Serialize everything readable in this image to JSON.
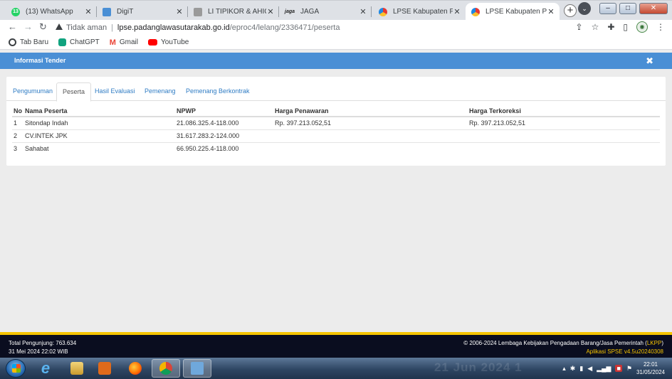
{
  "browser": {
    "tabs": [
      {
        "label": "(13) WhatsApp",
        "icon": "whatsapp-icon",
        "color": "#25d366",
        "badge": "13"
      },
      {
        "label": "DigiT",
        "icon": "document-icon",
        "color": "#4a8fd5",
        "badge": ""
      },
      {
        "label": "LI TIPIKOR & AHICW",
        "icon": "emblem-icon",
        "color": "#9a9a9a",
        "badge": ""
      },
      {
        "label": "JAGA",
        "icon": "jaga-icon",
        "color": "#222222",
        "badge": "jaga"
      },
      {
        "label": "LPSE Kabupaten Padan",
        "icon": "lpse-icon",
        "color": "#e53935",
        "badge": ""
      },
      {
        "label": "LPSE Kabupaten Padan",
        "icon": "lpse-icon",
        "color": "#e53935",
        "badge": ""
      }
    ],
    "active_tab_index": 5,
    "address": {
      "security_label": "Tidak aman",
      "host": "lpse.padanglawasutarakab.go.id",
      "path": "/eproc4/lelang/2336471/peserta"
    },
    "bookmarks": [
      {
        "label": "Tab Baru",
        "icon": "chrome-icon",
        "color": "#3c4043"
      },
      {
        "label": "ChatGPT",
        "icon": "chatgpt-icon",
        "color": "#10a37f"
      },
      {
        "label": "Gmail",
        "icon": "gmail-icon",
        "color": "#ea4335"
      },
      {
        "label": "YouTube",
        "icon": "youtube-icon",
        "color": "#ff0000"
      }
    ]
  },
  "modal": {
    "title": "Informasi Tender",
    "close_glyph": "✖"
  },
  "tabs": [
    {
      "label": "Pengumuman",
      "active": false
    },
    {
      "label": "Peserta",
      "active": true
    },
    {
      "label": "Hasil Evaluasi",
      "active": false
    },
    {
      "label": "Pemenang",
      "active": false
    },
    {
      "label": "Pemenang Berkontrak",
      "active": false
    }
  ],
  "table": {
    "columns": [
      "No",
      "Nama Peserta",
      "NPWP",
      "Harga Penawaran",
      "Harga Terkoreksi"
    ],
    "rows": [
      [
        "1",
        "Sitondap Indah",
        "21.086.325.4-118.000",
        "Rp. 397.213.052,51",
        "Rp. 397.213.052,51"
      ],
      [
        "2",
        "CV.INTEK JPK",
        "31.617.283.2-124.000",
        "",
        ""
      ],
      [
        "3",
        "Sahabat",
        "66.950.225.4-118.000",
        "",
        ""
      ]
    ]
  },
  "footer": {
    "visitors": "Total Pengunjung: 763.634",
    "datetime": "31 Mei 2024 22:02 WIB",
    "copyright": "© 2006-2024 Lembaga Kebijakan Pengadaan Barang/Jasa Pemerintah (",
    "copyright_link": "LKPP",
    "copyright_end": ")",
    "app_version": "Aplikasi SPSE v4.5u20240308"
  },
  "taskbar": {
    "time": "22:01",
    "date": "31/05/2024",
    "watermark": "21 Jun 2024 1",
    "colors": {
      "accent": "#4a8fd5",
      "footer_border": "#f5c400",
      "footer_bg": "#0a0d1f"
    }
  }
}
